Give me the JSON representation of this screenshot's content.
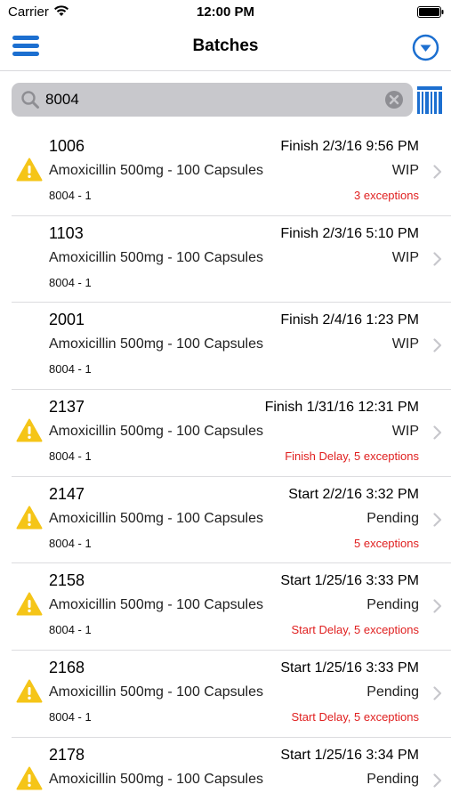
{
  "status_bar": {
    "carrier": "Carrier",
    "time": "12:00 PM"
  },
  "nav": {
    "title": "Batches"
  },
  "search": {
    "value": "8004"
  },
  "colors": {
    "accent": "#1c6fd0",
    "warning": "#f5c518",
    "error": "#e02020"
  },
  "batches": [
    {
      "id": "1006",
      "time_label": "Finish 2/3/16 9:56 PM",
      "product": "Amoxicillin 500mg - 100 Capsules",
      "status": "WIP",
      "lot": "8004 - 1",
      "exceptions": "3 exceptions",
      "warning": true
    },
    {
      "id": "1103",
      "time_label": "Finish 2/3/16 5:10 PM",
      "product": "Amoxicillin 500mg - 100 Capsules",
      "status": "WIP",
      "lot": "8004 - 1",
      "exceptions": "",
      "warning": false
    },
    {
      "id": "2001",
      "time_label": "Finish 2/4/16 1:23 PM",
      "product": "Amoxicillin 500mg - 100 Capsules",
      "status": "WIP",
      "lot": "8004 - 1",
      "exceptions": "",
      "warning": false
    },
    {
      "id": "2137",
      "time_label": "Finish 1/31/16 12:31 PM",
      "product": "Amoxicillin 500mg - 100 Capsules",
      "status": "WIP",
      "lot": "8004 - 1",
      "exceptions": "Finish Delay, 5 exceptions",
      "warning": true
    },
    {
      "id": "2147",
      "time_label": "Start 2/2/16 3:32 PM",
      "product": "Amoxicillin 500mg - 100 Capsules",
      "status": "Pending",
      "lot": "8004 - 1",
      "exceptions": "5 exceptions",
      "warning": true
    },
    {
      "id": "2158",
      "time_label": "Start 1/25/16 3:33 PM",
      "product": "Amoxicillin 500mg - 100 Capsules",
      "status": "Pending",
      "lot": "8004 - 1",
      "exceptions": "Start Delay, 5 exceptions",
      "warning": true
    },
    {
      "id": "2168",
      "time_label": "Start 1/25/16 3:33 PM",
      "product": "Amoxicillin 500mg - 100 Capsules",
      "status": "Pending",
      "lot": "8004 - 1",
      "exceptions": "Start Delay, 5 exceptions",
      "warning": true
    },
    {
      "id": "2178",
      "time_label": "Start 1/25/16 3:34 PM",
      "product": "Amoxicillin 500mg - 100 Capsules",
      "status": "Pending",
      "lot": "",
      "exceptions": "",
      "warning": true
    }
  ]
}
